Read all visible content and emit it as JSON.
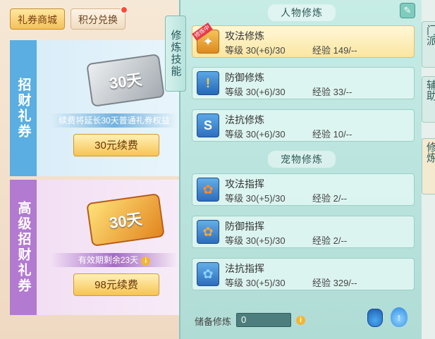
{
  "shop": {
    "tabs": [
      {
        "label": "礼券商城",
        "active": true
      },
      {
        "label": "积分兑换",
        "active": false,
        "has_notice": true
      }
    ],
    "cards": [
      {
        "side_title": "招财礼券",
        "ticket_days": "30天",
        "note": "续费将延长30天普通礼券权益",
        "button": "30元续费"
      },
      {
        "side_title": "高级招财礼券",
        "ticket_days": "30天",
        "note": "有效期剩余23天",
        "button": "98元续费"
      }
    ]
  },
  "training": {
    "side_tab": "修炼技能",
    "person_section": "人物修炼",
    "pet_section": "宠物修炼",
    "person_items": [
      {
        "name": "攻法修炼",
        "level": "等级  30(+6)/30",
        "exp": "经验  149/--",
        "badge": "修炼中",
        "icon": "attack-rune-icon",
        "selected": true
      },
      {
        "name": "防御修炼",
        "level": "等级  30(+6)/30",
        "exp": "经验  33/--",
        "icon": "defense-shield-icon"
      },
      {
        "name": "法抗修炼",
        "level": "等级  30(+6)/30",
        "exp": "经验  10/--",
        "icon": "resist-shield-icon"
      }
    ],
    "pet_items": [
      {
        "name": "攻法指挥",
        "level": "等级  30(+5)/30",
        "exp": "经验  2/--",
        "icon": "paw-attack-icon"
      },
      {
        "name": "防御指挥",
        "level": "等级  30(+5)/30",
        "exp": "经验  2/--",
        "icon": "paw-defense-icon"
      },
      {
        "name": "法抗指挥",
        "level": "等级  30(+5)/30",
        "exp": "经验  329/--",
        "icon": "paw-resist-icon"
      }
    ],
    "storage_label": "储备修炼",
    "storage_value": "0"
  },
  "right_tabs": [
    {
      "label": "门派"
    },
    {
      "label": "辅助"
    },
    {
      "label": "修炼"
    }
  ]
}
